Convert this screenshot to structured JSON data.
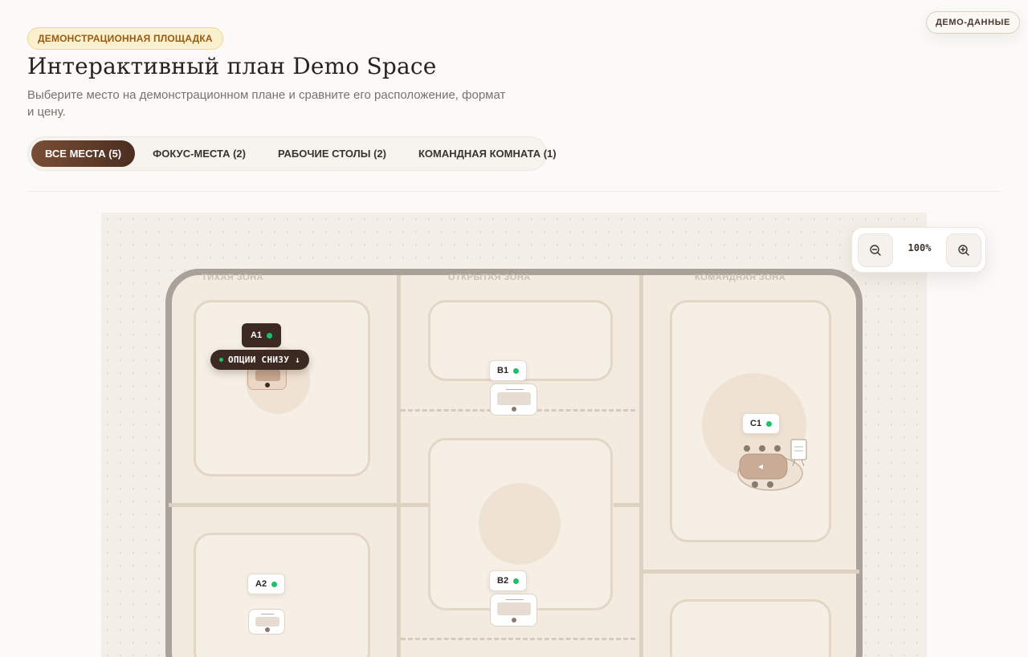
{
  "header": {
    "badge": "ДЕМОНСТРАЦИОННАЯ ПЛОЩАДКА",
    "demo_badge": "ДЕМО-ДАННЫЕ",
    "title": "Интерактивный план Demo Space",
    "subtitle": "Выберите место на демонстрационном плане и сравните его расположение, формат и цену."
  },
  "tabs": [
    {
      "label": "ВСЕ МЕСТА (5)",
      "active": true
    },
    {
      "label": "ФОКУС-МЕСТА (2)",
      "active": false
    },
    {
      "label": "РАБОЧИЕ СТОЛЫ (2)",
      "active": false
    },
    {
      "label": "КОМАНДНАЯ КОМНАТА (1)",
      "active": false
    }
  ],
  "zones": {
    "quiet": "ТИХАЯ ЗОНА",
    "open": "ОТКРЫТАЯ ЗОНА",
    "team": "КОМАНДНАЯ ЗОНА"
  },
  "seats": {
    "a1": "A1",
    "a2": "A2",
    "b1": "B1",
    "b2": "B2",
    "c1": "C1"
  },
  "tooltip": "ОПЦИИ СНИЗУ ↓",
  "zoom": {
    "level": "100%"
  },
  "colors": {
    "accent": "#5a3827",
    "available": "#1fbf6a",
    "badge_bg": "#fcf1cf"
  }
}
